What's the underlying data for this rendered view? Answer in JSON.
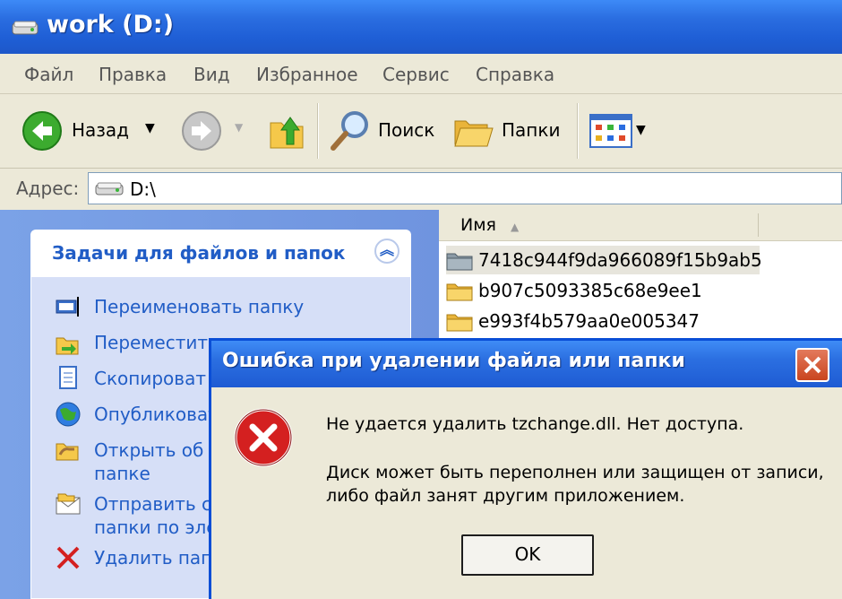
{
  "window": {
    "title": "work (D:)"
  },
  "menu": [
    "Файл",
    "Правка",
    "Вид",
    "Избранное",
    "Сервис",
    "Справка"
  ],
  "toolbar": {
    "back_label": "Назад",
    "search_label": "Поиск",
    "folders_label": "Папки"
  },
  "address": {
    "label": "Адрес:",
    "value": "D:\\"
  },
  "task_panel": {
    "title": "Задачи для файлов и папок",
    "items": [
      {
        "label": "Переименовать папку",
        "icon": "rename-folder-icon"
      },
      {
        "label": "Переместить",
        "icon": "move-folder-icon"
      },
      {
        "label": "Скопироват",
        "icon": "copy-folder-icon"
      },
      {
        "label": "Опубликоват",
        "icon": "publish-web-icon"
      },
      {
        "label": "Открыть об\nпапке",
        "icon": "share-folder-icon"
      },
      {
        "label": "Отправить с\nпапки по эле",
        "icon": "email-folder-icon"
      },
      {
        "label": "Удалить пап",
        "icon": "delete-icon"
      }
    ]
  },
  "file_list": {
    "column_name": "Имя",
    "items": [
      "7418c944f9da966089f15b9ab5",
      "b907c5093385c68e9ee1",
      "e993f4b579aa0e005347"
    ]
  },
  "dialog": {
    "title": "Ошибка при удалении файла или папки",
    "message_line1": "Не удается удалить tzchange.dll. Нет доступа.",
    "message_line2": "Диск может быть переполнен или защищен от записи,\nлибо файл занят другим приложением.",
    "ok_label": "OK"
  },
  "colors": {
    "titlebar_blue": "#2a6de0",
    "task_link": "#215dc6",
    "error_red": "#d42020"
  }
}
